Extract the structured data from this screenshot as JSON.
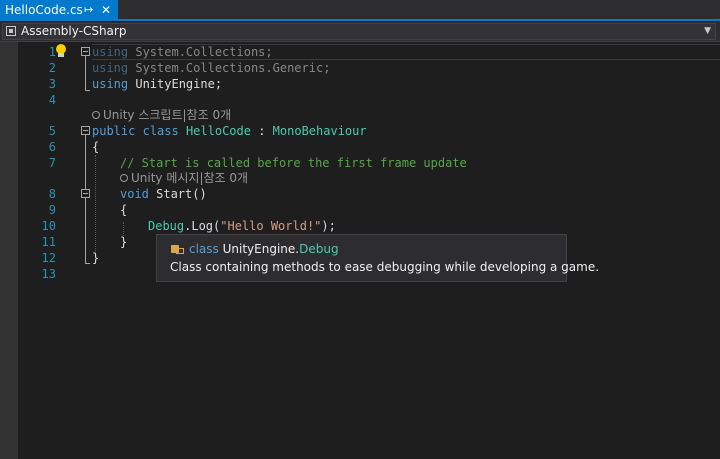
{
  "tab": {
    "title": "HelloCode.cs",
    "pin": "↦",
    "close": "✕"
  },
  "navbar": {
    "project": "Assembly-CSharp"
  },
  "line_numbers": [
    "1",
    "2",
    "3",
    "4",
    "5",
    "6",
    "7",
    "8",
    "9",
    "10",
    "11",
    "12",
    "13"
  ],
  "code": {
    "l1_kw": "using",
    "l1_rest": " System.Collections;",
    "l2_kw": "using",
    "l2_rest": " System.Collections.Generic;",
    "l3_kw": "using",
    "l3_rest": " UnityEngine;",
    "lens1": "Unity 스크립트|참조 0개",
    "l5_kw1": "public",
    "l5_kw2": "class",
    "l5_name": "HelloCode",
    "l5_colon": " : ",
    "l5_base": "MonoBehaviour",
    "l6": "{",
    "l7": "// Start is called before the first frame update",
    "lens2": "Unity 메시지|참조 0개",
    "l8_kw": "void",
    "l8_rest": " Start()",
    "l9": "{",
    "l10_type": "Debug",
    "l10_mid": ".Log(",
    "l10_str": "\"Hello World!\"",
    "l10_end": ");",
    "l11": "}",
    "l12": "}"
  },
  "tooltip": {
    "kind": "class",
    "namespace": "UnityEngine.",
    "type": "Debug",
    "description": "Class containing methods to ease debugging while developing a game."
  },
  "colors": {
    "tab_active": "#007acc",
    "keyword": "#569cd6",
    "type": "#4ec9b0",
    "comment": "#57a64a",
    "string": "#d69d85",
    "line_number": "#2b91af"
  }
}
